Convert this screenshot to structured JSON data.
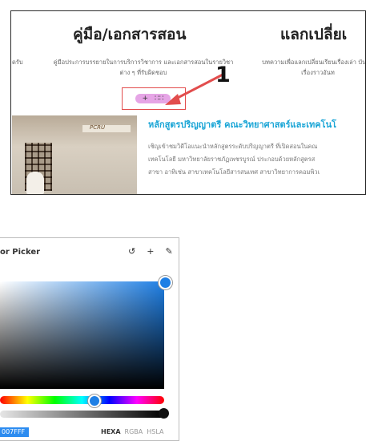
{
  "top_panel": {
    "heading_manual": "คู่มือ/เอกสารสอน",
    "heading_exchange": "แลกเปลี่ยเ",
    "left_edge_text": "ดรับ",
    "manual_desc": "คู่มือประการบรรยายในการบริการวิชาการ และเอกสารสอนในรายวิชาต่าง ๆ ที่รับผิดชอบ",
    "exchange_desc": "บทความเพื่อแลกเปลี่ยนเรียนเรื่องเล่า บันทึกเรื่องราวอันท",
    "add_section_plus": "+",
    "add_section_drag": "∷∷",
    "callout_number": "1",
    "photo_sign": "PCRU",
    "course_title": "หลักสูตรปริญญาตรี คณะวิทยาศาสตร์และเทคโนโ",
    "course_desc_lines": [
      "เชิญเข้าชมวิดีโอแนะนำหลักสูตรระดับปริญญาตรี ที่เปิดสอนในคณ",
      "เทคโนโลยี มหาวิทยาลัยราชภัฏเพชรบูรณ์ ประกอบด้วยหลักสูตรส",
      "สาขา อาทิเช่น สาขาเทคโนโลยีสารสนเทศ สาขาวิทยาการคอมพิวเ"
    ]
  },
  "color_picker": {
    "title": "or Picker",
    "icons": [
      "reset-icon",
      "add-icon",
      "eyedropper-icon"
    ],
    "icon_glyphs": [
      "↺",
      "+",
      "✎"
    ],
    "hex_value": "007FFF",
    "selected_color": "#1e7fe5",
    "format_options": [
      "HEXA",
      "RGBA",
      "HSLA"
    ],
    "active_format": "HEXA"
  },
  "colors": {
    "callout_border": "#e24d4d",
    "add_section_pill": "#e6a5e6",
    "course_title": "#1aa5d6",
    "hex_field": "#2d8cf0"
  }
}
